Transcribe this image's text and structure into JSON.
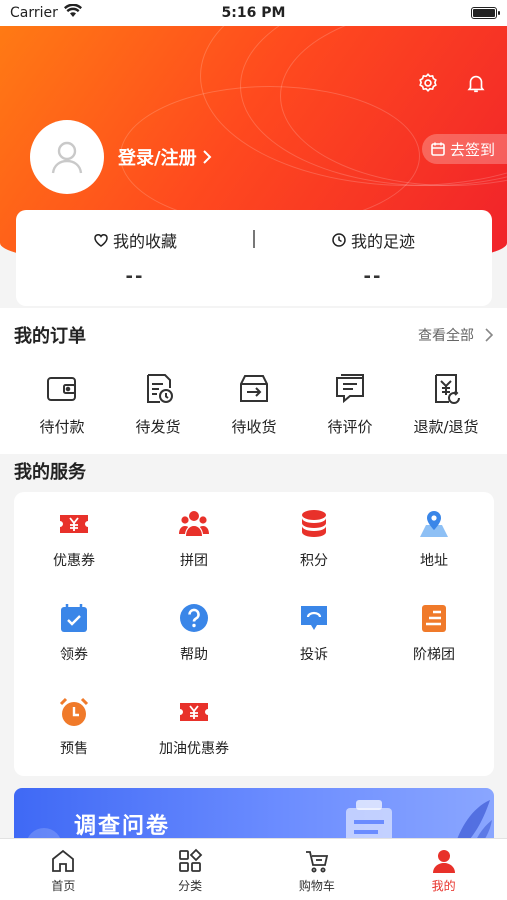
{
  "status_bar": {
    "carrier": "Carrier",
    "time": "5:16 PM",
    "battery_level": 1.0
  },
  "header": {
    "login_label": "登录/注册",
    "checkin_label": "去签到"
  },
  "favorites": {
    "favorites_label": "我的收藏",
    "favorites_value": "--",
    "history_label": "我的足迹",
    "history_value": "--"
  },
  "orders": {
    "title": "我的订单",
    "view_all": "查看全部",
    "items": [
      {
        "label": "待付款",
        "icon": "wallet-icon"
      },
      {
        "label": "待发货",
        "icon": "pending-ship-icon"
      },
      {
        "label": "待收货",
        "icon": "receive-box-icon"
      },
      {
        "label": "待评价",
        "icon": "review-icon"
      },
      {
        "label": "退款/退货",
        "icon": "refund-icon"
      }
    ]
  },
  "services": {
    "title": "我的服务",
    "items": [
      {
        "label": "优惠券",
        "icon": "coupon-icon",
        "color": "#e8312a"
      },
      {
        "label": "拼团",
        "icon": "group-icon",
        "color": "#e8312a"
      },
      {
        "label": "积分",
        "icon": "points-icon",
        "color": "#e8312a"
      },
      {
        "label": "地址",
        "icon": "location-icon",
        "color": "#3a86e8"
      },
      {
        "label": "领券",
        "icon": "calendar-check-icon",
        "color": "#3a86e8"
      },
      {
        "label": "帮助",
        "icon": "help-icon",
        "color": "#3a86e8"
      },
      {
        "label": "投诉",
        "icon": "complaint-icon",
        "color": "#3a86e8"
      },
      {
        "label": "阶梯团",
        "icon": "ladder-group-icon",
        "color": "#f07a2a"
      },
      {
        "label": "预售",
        "icon": "alarm-clock-icon",
        "color": "#f07a2a"
      },
      {
        "label": "加油优惠券",
        "icon": "fuel-coupon-icon",
        "color": "#e8312a"
      }
    ]
  },
  "banner": {
    "title": "调查问卷"
  },
  "tabbar": {
    "items": [
      {
        "label": "首页",
        "icon": "home-icon"
      },
      {
        "label": "分类",
        "icon": "category-icon"
      },
      {
        "label": "购物车",
        "icon": "cart-icon"
      },
      {
        "label": "我的",
        "icon": "profile-icon"
      }
    ],
    "active_color": "#e8312a"
  }
}
